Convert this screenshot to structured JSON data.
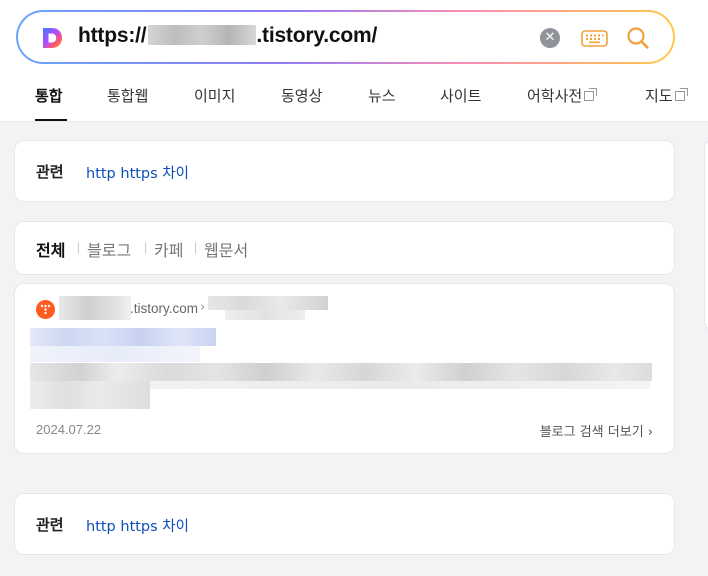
{
  "search": {
    "url_prefix": "https://",
    "url_suffix": ".tistory.com/"
  },
  "tabs": [
    {
      "label": "통합",
      "active": true
    },
    {
      "label": "통합웹"
    },
    {
      "label": "이미지"
    },
    {
      "label": "동영상"
    },
    {
      "label": "뉴스"
    },
    {
      "label": "사이트"
    },
    {
      "label": "어학사전"
    },
    {
      "label": "지도"
    }
  ],
  "related_top": {
    "title": "관련",
    "link": "http https 차이"
  },
  "filters": [
    {
      "label": "전체",
      "active": true
    },
    {
      "label": "블로그"
    },
    {
      "label": "카페"
    },
    {
      "label": "웹문서"
    }
  ],
  "result": {
    "domain": ".tistory.com",
    "breadcrumb_arrow": "›",
    "date": "2024.07.22",
    "more_label": "블로그 검색 더보기",
    "more_arrow": "›"
  },
  "related_bottom": {
    "title": "관련",
    "link": "http https 차이"
  },
  "colors": {
    "link": "#0d4fbd",
    "favicon": "#ff5a1f",
    "search_icon": "#f0a13a"
  },
  "icons": [
    "daum-logo-icon",
    "clear-icon",
    "keyboard-icon",
    "search-icon",
    "external-window-icon",
    "tistory-favicon-icon"
  ]
}
